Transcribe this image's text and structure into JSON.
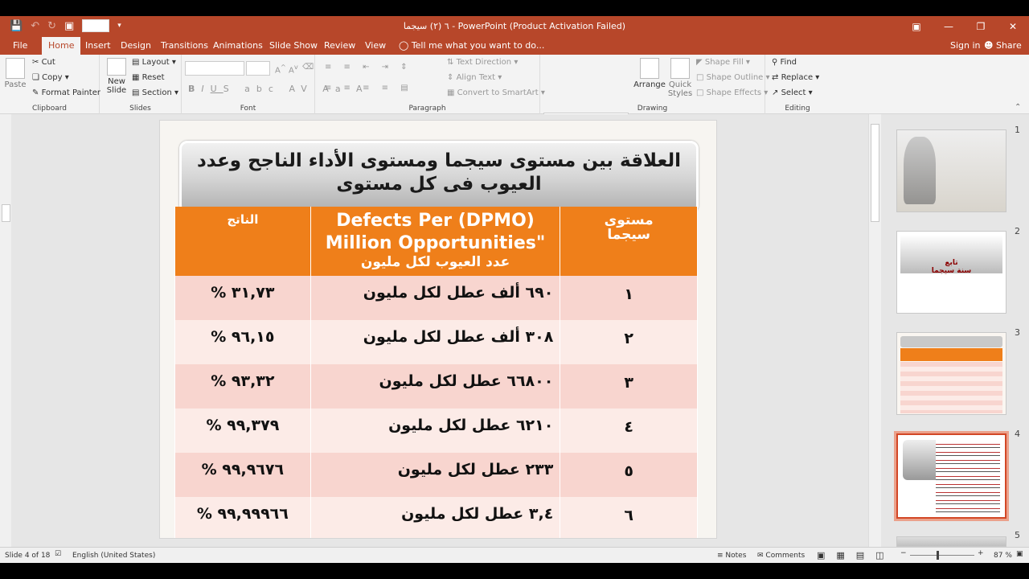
{
  "window": {
    "title": "٦ (٢) سيجما - PowerPoint (Product Activation Failed)"
  },
  "tabs": [
    "File",
    "Home",
    "Insert",
    "Design",
    "Transitions",
    "Animations",
    "Slide Show",
    "Review",
    "View"
  ],
  "tell_me": "Tell me what you want to do...",
  "account": {
    "sign_in": "Sign in",
    "share": "Share"
  },
  "ribbon": {
    "clipboard": {
      "paste": "Paste",
      "cut": "Cut",
      "copy": "Copy",
      "format_painter": "Format Painter",
      "label": "Clipboard"
    },
    "slides": {
      "new_slide_1": "New",
      "new_slide_2": "Slide",
      "layout": "Layout",
      "reset": "Reset",
      "section": "Section",
      "label": "Slides"
    },
    "font": {
      "label": "Font"
    },
    "paragraph": {
      "text_direction": "Text Direction",
      "align_text": "Align Text",
      "convert_smartart": "Convert to SmartArt",
      "label": "Paragraph"
    },
    "drawing": {
      "arrange": "Arrange",
      "quick_styles_1": "Quick",
      "quick_styles_2": "Styles",
      "shape_fill": "Shape Fill",
      "shape_outline": "Shape Outline",
      "shape_effects": "Shape Effects",
      "label": "Drawing"
    },
    "editing": {
      "find": "Find",
      "replace": "Replace",
      "select": "Select",
      "label": "Editing"
    }
  },
  "slide": {
    "title_line1": "العلاقة بين مستوى سيجما ومستوى الأداء الناجح وعدد",
    "title_line2": "العيوب فى كل مستوى",
    "header": {
      "col_result": "الناتج",
      "col_dpmo_en1": "Defects Per (DPMO)",
      "col_dpmo_en2": "Million Opportunities\"",
      "col_dpmo_ar": "عدد العيوب لكل مليون",
      "col_level1": "مستوى",
      "col_level2": "سيجما"
    },
    "rows": [
      {
        "pct": "% ٣١,٧٣",
        "defects": "٦٩٠ ألف عطل لكل مليون",
        "level": "١"
      },
      {
        "pct": "% ٩٦,١٥",
        "defects": "٣٠٨ ألف عطل لكل مليون",
        "level": "٢"
      },
      {
        "pct": "% ٩٣,٣٢",
        "defects": "٦٦٨٠٠ عطل لكل مليون",
        "level": "٣"
      },
      {
        "pct": "% ٩٩,٣٧٩",
        "defects": "٦٢١٠ عطل لكل مليون",
        "level": "٤"
      },
      {
        "pct": "% ٩٩,٩٦٧٦",
        "defects": "٢٣٣ عطل لكل مليون",
        "level": "٥"
      },
      {
        "pct": "% ٩٩,٩٩٩٦٦",
        "defects": "٣,٤ عطل لكل مليون",
        "level": "٦"
      }
    ]
  },
  "thumbnails": {
    "numbers": [
      "1",
      "2",
      "3",
      "4",
      "5"
    ],
    "t2_line1": "تابع",
    "t2_line2": "سنة سيجما"
  },
  "status": {
    "slide": "Slide 4 of 18",
    "language": "English (United States)",
    "notes": "Notes",
    "comments": "Comments",
    "zoom": "87 %"
  },
  "colors": {
    "accent": "#b7472a",
    "table_header": "#ef7f1a"
  }
}
